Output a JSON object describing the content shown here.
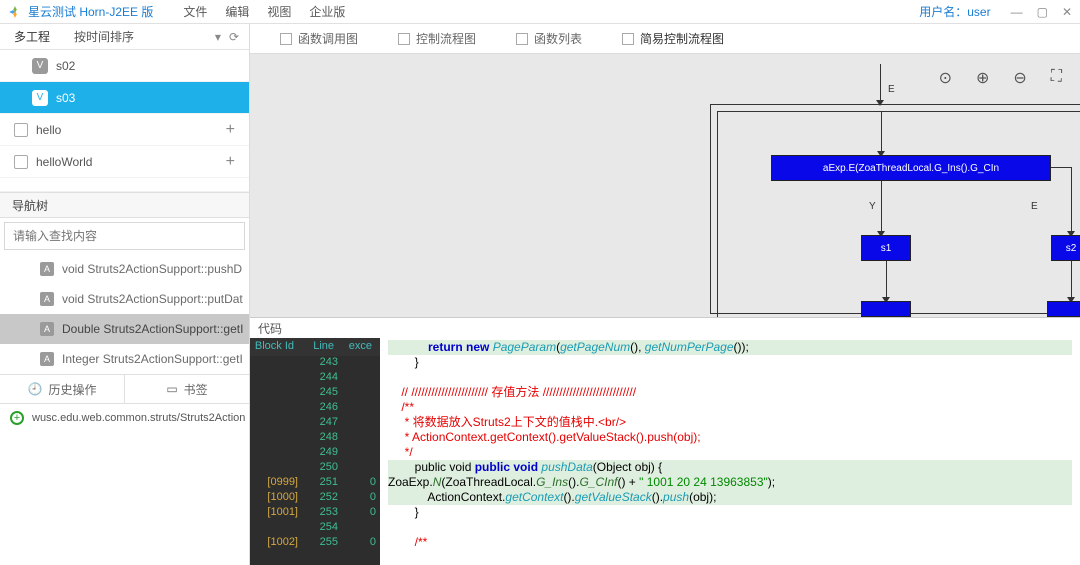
{
  "titlebar": {
    "title": "星云测试 Horn-J2EE 版",
    "menu": [
      "文件",
      "编辑",
      "视图",
      "企业版"
    ],
    "user_label": "用户名：",
    "user_name": "user"
  },
  "sidebar": {
    "tab": "多工程",
    "sort": "按时间排序",
    "items": [
      {
        "badge": "V",
        "label": "s02",
        "selected": false
      },
      {
        "badge": "V",
        "label": "s03",
        "selected": true
      }
    ],
    "projects": [
      {
        "label": "hello"
      },
      {
        "label": "helloWorld"
      }
    ],
    "nav_header": "导航树",
    "search_placeholder": "请输入查找内容",
    "functions": [
      {
        "label": "void Struts2ActionSupport::pushD",
        "sel": false
      },
      {
        "label": "void Struts2ActionSupport::putDat",
        "sel": false
      },
      {
        "label": "Double Struts2ActionSupport::getI",
        "sel": true
      },
      {
        "label": "Integer Struts2ActionSupport::getI",
        "sel": false
      }
    ],
    "hist_tabs": [
      "历史操作",
      "书签"
    ],
    "hist_item": "wusc.edu.web.common.struts/Struts2Action"
  },
  "tabs": [
    {
      "label": "函数调用图"
    },
    {
      "label": "控制流程图"
    },
    {
      "label": "函数列表"
    },
    {
      "label": "简易控制流程图",
      "active": true
    }
  ],
  "diagram": {
    "main_node": "aExp.E(ZoaThreadLocal.G_Ins().G_CIn",
    "s1": "s1",
    "s2": "s2",
    "e1": "E",
    "y": "Y",
    "e2": "E"
  },
  "code": {
    "header": "代码",
    "gutter_headers": {
      "block": "Block Id",
      "line": "Line",
      "exce": "exce"
    },
    "rows": [
      {
        "b": "",
        "l": "243",
        "e": ""
      },
      {
        "b": "",
        "l": "244",
        "e": ""
      },
      {
        "b": "",
        "l": "245",
        "e": ""
      },
      {
        "b": "",
        "l": "246",
        "e": ""
      },
      {
        "b": "",
        "l": "247",
        "e": ""
      },
      {
        "b": "",
        "l": "248",
        "e": ""
      },
      {
        "b": "",
        "l": "249",
        "e": ""
      },
      {
        "b": "",
        "l": "250",
        "e": ""
      },
      {
        "b": "[0999]",
        "l": "251",
        "e": "0"
      },
      {
        "b": "[1000]",
        "l": "252",
        "e": "0"
      },
      {
        "b": "[1001]",
        "l": "253",
        "e": "0"
      },
      {
        "b": "",
        "l": "254",
        "e": ""
      },
      {
        "b": "[1002]",
        "l": "255",
        "e": "0"
      }
    ],
    "lines": {
      "l0": "            return new ",
      "l0b": "PageParam",
      "l0c": "(",
      "l0d": "getPageNum",
      "l0e": "(), ",
      "l0f": "getNumPerPage",
      "l0g": "());",
      "l1": "        }",
      "l2": "",
      "l3": "    // /////////////////////// 存值方法 ////////////////////////////",
      "l4": "    /**",
      "l5": "     * 将数据放入Struts2上下文的值栈中.<br/>",
      "l6": "     * ActionContext.getContext().getValueStack().push(obj);",
      "l7": "     */",
      "l8a": "        public void ",
      "l8b": "pushData",
      "l8c": "(Object obj) {",
      "l9a": "ZoaExp.",
      "l9b": "N",
      "l9c": "(ZoaThreadLocal.",
      "l9d": "G_Ins",
      "l9e": "().",
      "l9f": "G_CInf",
      "l9g": "() + ",
      "l9h": "\" 1001 20 24 13963853\"",
      "l9i": ");",
      "l10a": "            ActionContext.",
      "l10b": "getContext",
      "l10c": "().",
      "l10d": "getValueStack",
      "l10e": "().",
      "l10f": "push",
      "l10g": "(obj);",
      "l11": "        }",
      "l12": "",
      "l13": "        /**"
    }
  }
}
